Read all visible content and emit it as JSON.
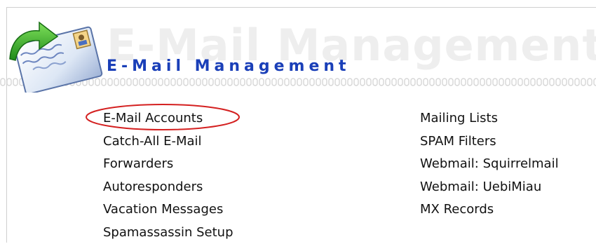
{
  "header": {
    "title": "E-Mail Management",
    "watermark_text": "E-Mail Management",
    "icon": "email-envelope-icon",
    "title_color": "#1a3fb8",
    "watermark_color": "#eeeeee"
  },
  "menu": {
    "left": [
      {
        "label": "E-Mail Accounts",
        "highlighted": true
      },
      {
        "label": "Catch-All E-Mail"
      },
      {
        "label": "Forwarders"
      },
      {
        "label": "Autoresponders"
      },
      {
        "label": "Vacation Messages"
      },
      {
        "label": "Spamassassin Setup"
      }
    ],
    "right": [
      {
        "label": "Mailing Lists"
      },
      {
        "label": "SPAM Filters"
      },
      {
        "label": "Webmail: Squirrelmail"
      },
      {
        "label": "Webmail: UebiMiau"
      },
      {
        "label": "MX Records"
      }
    ]
  },
  "highlight_color": "#d42020"
}
